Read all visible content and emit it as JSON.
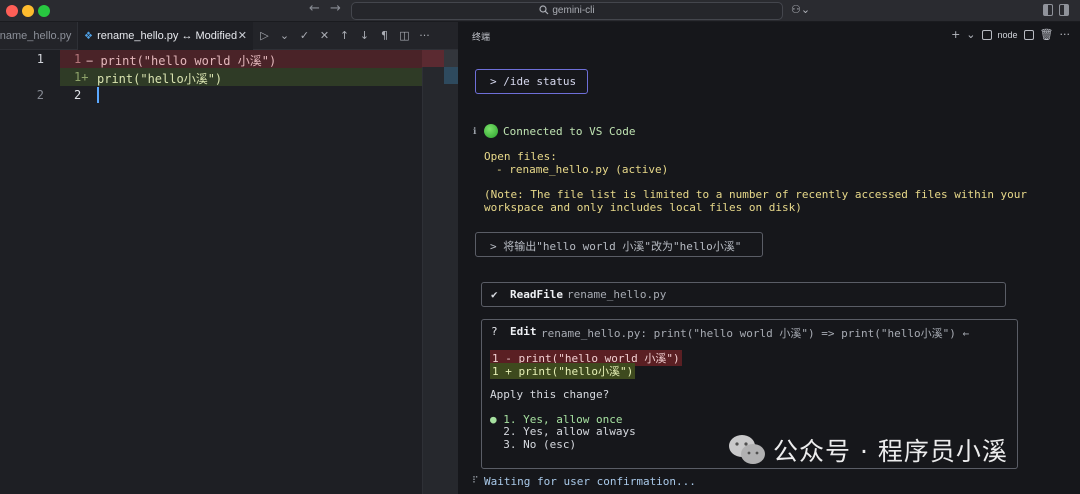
{
  "window": {
    "nav_back": "←",
    "nav_forward": "→",
    "command_center": "gemini-cli",
    "copilot": "⚇⌄"
  },
  "editor": {
    "prev_tab": "rename_hello.py",
    "active_tab": "rename_hello.py ↔ Modified",
    "close": "✕",
    "toolbar": [
      "▷",
      "⌄",
      "✓",
      "✕",
      "↑",
      "↓",
      "¶",
      "◫",
      "···"
    ],
    "left_lines": [
      "1",
      "2"
    ],
    "right_lines": [
      "1",
      "1+",
      "2"
    ],
    "deleted_line": "− print(\"hello world 小溪\")",
    "added_line": "print(\"hello小溪\")"
  },
  "terminal": {
    "title": "终端",
    "actions": {
      "plus": "+",
      "chevron": "⌄",
      "shell": "node",
      "more": "···"
    },
    "ide_command": "> /ide status",
    "connected_mark": "ℹ",
    "connected": "Connected to VS Code",
    "open_files_title": "Open files:",
    "open_file": "- rename_hello.py (active)",
    "note_line1": "(Note: The file list is limited to a number of recently accessed files within your",
    "note_line2": "workspace and only includes local files on disk)",
    "prompt": "> 将输出\"hello world 小溪\"改为\"hello小溪\"",
    "readfile": {
      "check": "✔",
      "name": "ReadFile",
      "arg": "rename_hello.py"
    },
    "edit": {
      "mark": "?",
      "name": "Edit",
      "arg": "rename_hello.py: print(\"hello world 小溪\") => print(\"hello小溪\") ←",
      "diff_del": "1 - print(\"hello world 小溪\")",
      "diff_add": "1 + print(\"hello小溪\")",
      "question": "Apply this change?",
      "options": [
        "● 1. Yes, allow once",
        "  2. Yes, allow always",
        "  3. No (esc)"
      ]
    },
    "waiting_mark": "⠏",
    "waiting": "Waiting for user confirmation..."
  },
  "watermark": "公众号 · 程序员小溪",
  "colors": {
    "accent_box": "#6e6fd8",
    "diff_deleted": "#5a1f23",
    "diff_added": "#3e4a1e",
    "connected_green": "#2aa12d"
  }
}
